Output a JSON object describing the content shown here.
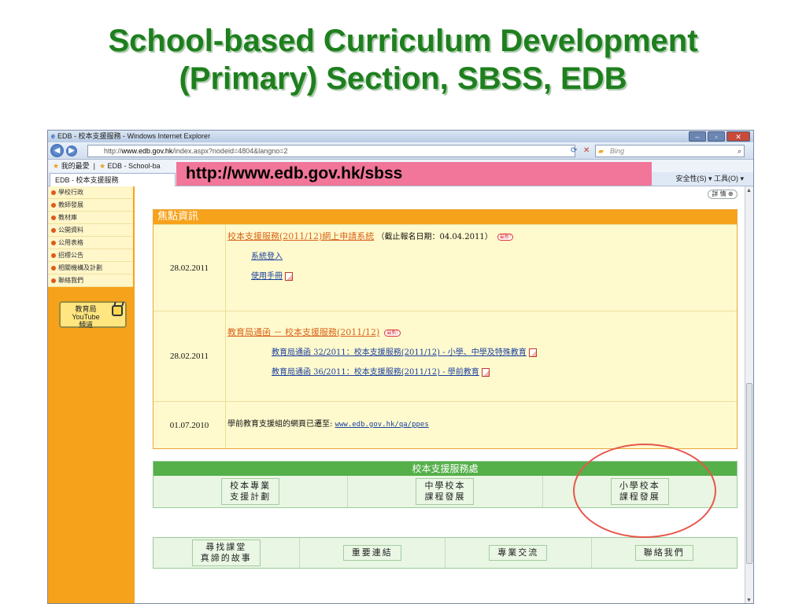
{
  "slide": {
    "title_line1": "School-based Curriculum Development",
    "title_line2": "(Primary) Section, SBSS, EDB"
  },
  "url_banner": "http://www.edb.gov.hk/sbss",
  "browser": {
    "window_title": "EDB - 校本支援服務 - Windows Internet Explorer",
    "address_prefix": "http://",
    "address_host": "www.edb.gov.hk",
    "address_path": "/index.aspx?nodeid=4804&langno=2",
    "search_placeholder": "Bing",
    "favorites_label": "我的最愛",
    "fav_link": "EDB - School-ba",
    "tab_label": "EDB - 校本支援服務",
    "tools_label": "安全性(S) ▾   工具(O) ▾"
  },
  "sidebar": {
    "items": [
      "學校行政",
      "教師發展",
      "教材庫",
      "公開資料",
      "公用表格",
      "招標公告",
      "相關機構及計劃",
      "聯絡我們"
    ],
    "youtube_line1": "教育局",
    "youtube_line2": "YouTube",
    "youtube_line3": "頻道"
  },
  "main": {
    "detail_label": "詳 情",
    "focus_header": "焦點資訊",
    "news": [
      {
        "date": "28.02.2011",
        "headline": "校本支援服務(2011/12)網上申請系統",
        "deadline": "（截止報名日期：04.04.2011）",
        "badge": "最新!",
        "link1": "系統登入",
        "link2": "使用手冊"
      },
      {
        "date": "28.02.2011",
        "headline": "教育局通函 － 校本支援服務(2011/12)",
        "badge": "最新!",
        "link1": "教育局通函 32/2011：校本支援服務(2011/12) - 小學、中學及特殊教育",
        "link2": "教育局通函 36/2011：校本支援服務(2011/12) - 學前教育"
      },
      {
        "date": "01.07.2010",
        "text": "學前教育支援組的網頁已遷至:",
        "link": "www.edb.gov.hk/qa/ppes"
      }
    ],
    "support_header": "校本支援服務處",
    "support_buttons": [
      "校本專業\n支援計劃",
      "中學校本\n課程發展",
      "小學校本\n課程發展"
    ],
    "bottom_links": [
      "尋找課堂\n真諦的故事",
      "重要連結",
      "專業交流",
      "聯絡我們"
    ]
  }
}
